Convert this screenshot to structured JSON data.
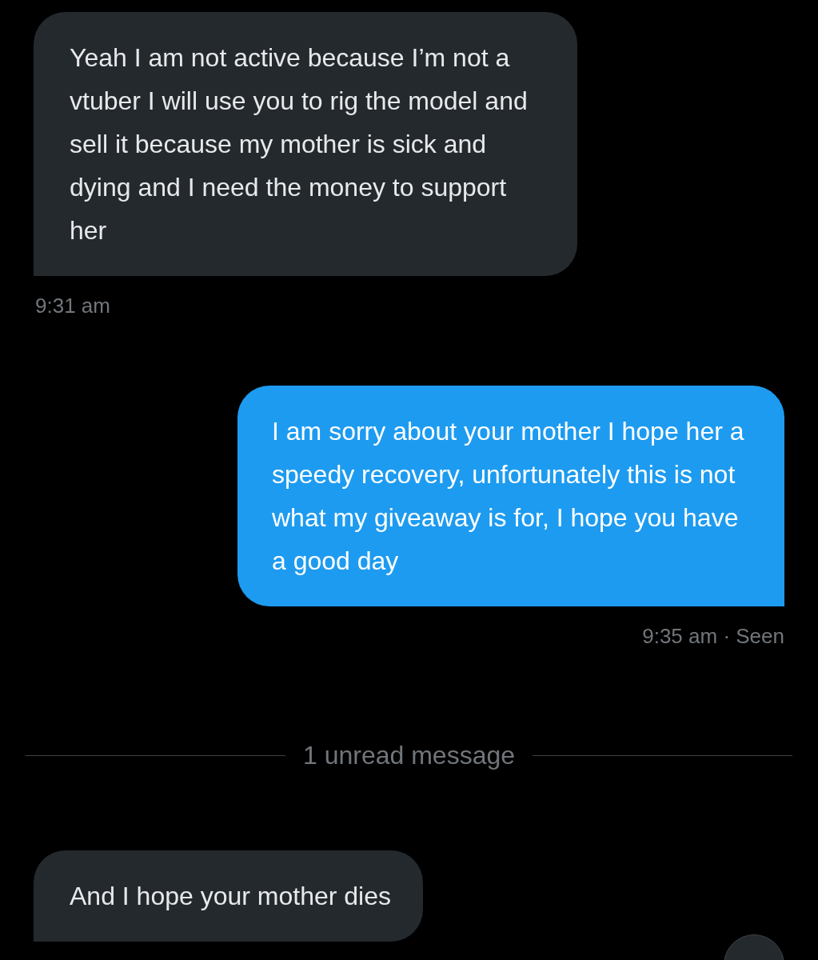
{
  "messages": [
    {
      "kind": "received",
      "text": "Yeah I am not active because I’m not a vtuber I will use you to rig the model and sell it because my mother is sick and dying and I need the money to support her",
      "meta": "9:31 am"
    },
    {
      "kind": "sent",
      "text": "I am sorry about your mother I hope her a speedy recovery, unfortunately this is not what my giveaway is for, I hope you have a good day",
      "meta": "9:35 am · Seen"
    },
    {
      "kind": "divider",
      "text": "1 unread message"
    },
    {
      "kind": "received",
      "text": "And I hope your mother dies"
    }
  ]
}
